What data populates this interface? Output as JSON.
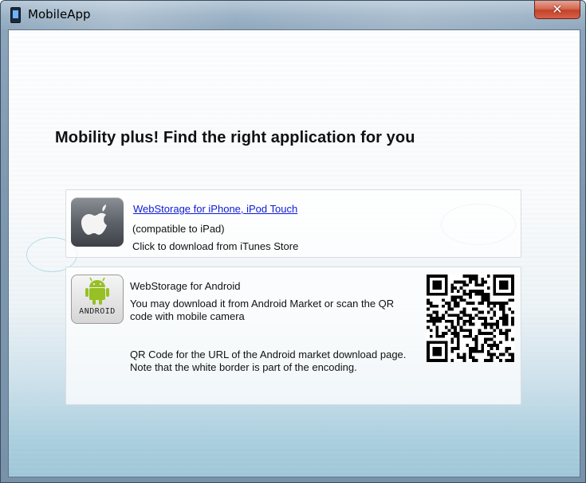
{
  "window": {
    "title": "MobileApp",
    "close_label": "✕"
  },
  "main": {
    "headline": "Mobility plus! Find the right application for you"
  },
  "ios": {
    "link": "WebStorage for iPhone, iPod Touch",
    "compat": "(compatible to iPad)",
    "action": "Click to download from iTunes Store"
  },
  "android": {
    "logo_text": "ANDROID",
    "title": "WebStorage for Android",
    "desc_line1": "You may download it from Android Market or scan the QR",
    "desc_line2": "code with mobile camera",
    "qr_note_line1": "QR Code for the URL of the Android market download page.",
    "qr_note_line2": "Note that the white border is part of the encoding."
  },
  "colors": {
    "link": "#0d1bd6",
    "android_green": "#97c024",
    "close_red": "#c2432a"
  }
}
